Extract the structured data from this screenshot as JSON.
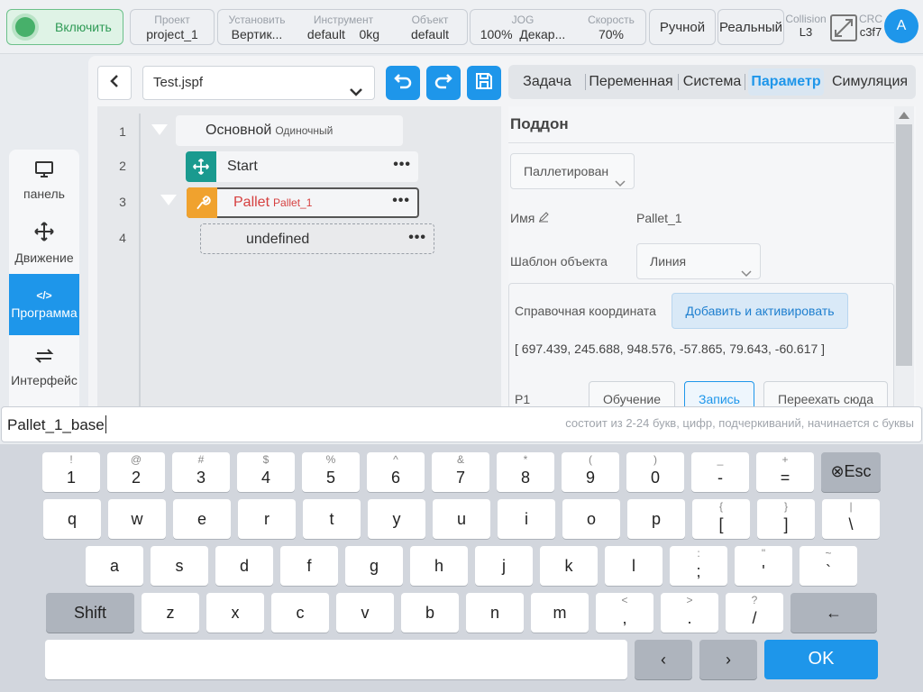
{
  "topbar": {
    "power_label": "Включить",
    "project": {
      "label": "Проект",
      "value": "project_1"
    },
    "install": {
      "label": "Установить",
      "value": "Вертик..."
    },
    "tool": {
      "label": "Инструмент",
      "value": "default",
      "value2": "0kg"
    },
    "object": {
      "label": "Объект",
      "value": "default"
    },
    "jog": {
      "label": "JOG",
      "value": "100%",
      "value2": "Декар..."
    },
    "speed": {
      "label": "Скорость",
      "value": "70%"
    },
    "mode_manual": "Ручной",
    "mode_real": "Реальный",
    "collision": {
      "label": "Collision",
      "value": "L3"
    },
    "crc": {
      "label": "CRC",
      "value": "c3f7"
    },
    "avatar": "A"
  },
  "leftnav": [
    {
      "label": "панель",
      "icon": "monitor-icon"
    },
    {
      "label": "Движение",
      "icon": "move-icon"
    },
    {
      "label": "Программа",
      "icon": "code-icon",
      "active": true
    },
    {
      "label": "Интерфейс",
      "icon": "interface-icon"
    }
  ],
  "editor": {
    "file_name": "Test.jspf",
    "lines": [
      "1",
      "2",
      "3",
      "4"
    ],
    "nodes": {
      "main": {
        "label": "Основной",
        "sub": "Одиночный"
      },
      "start": {
        "label": "Start"
      },
      "pallet": {
        "label": "Pallet",
        "sub": "Pallet_1"
      },
      "undefined": {
        "label": "undefined"
      }
    },
    "more": "•••"
  },
  "tabs": [
    "Задача",
    "Переменная",
    "Система",
    "Параметр",
    "Симуляция"
  ],
  "active_tab": "Параметр",
  "params": {
    "title": "Поддон",
    "type_select": "Паллетирован",
    "name_label": "Имя",
    "name_value": "Pallet_1",
    "template_label": "Шаблон объекта",
    "template_value": "Линия",
    "ref_label": "Справочная координата",
    "add_button": "Добавить и активировать",
    "coords": "[ 697.439, 245.688, 948.576, -57.865, 79.643, -60.617 ]",
    "p1_label": "P1",
    "btn_teach": "Обучение",
    "btn_record": "Запись",
    "btn_move": "Переехать сюда"
  },
  "input": {
    "value": "Pallet_1_base",
    "hint": "состоит из 2-24 букв, цифр, подчеркиваний, начинается с буквы"
  },
  "keyboard": {
    "row1": [
      {
        "m": "1",
        "s": "!"
      },
      {
        "m": "2",
        "s": "@"
      },
      {
        "m": "3",
        "s": "#"
      },
      {
        "m": "4",
        "s": "$"
      },
      {
        "m": "5",
        "s": "%"
      },
      {
        "m": "6",
        "s": "^"
      },
      {
        "m": "7",
        "s": "&"
      },
      {
        "m": "8",
        "s": "*"
      },
      {
        "m": "9",
        "s": "("
      },
      {
        "m": "0",
        "s": ")"
      },
      {
        "m": "-",
        "s": "_"
      },
      {
        "m": "=",
        "s": "+"
      }
    ],
    "esc": "⊗Esc",
    "row2": [
      {
        "m": "q"
      },
      {
        "m": "w"
      },
      {
        "m": "e"
      },
      {
        "m": "r"
      },
      {
        "m": "t"
      },
      {
        "m": "y"
      },
      {
        "m": "u"
      },
      {
        "m": "i"
      },
      {
        "m": "o"
      },
      {
        "m": "p"
      },
      {
        "m": "[",
        "s": "{"
      },
      {
        "m": "]",
        "s": "}"
      },
      {
        "m": "\\",
        "s": "|"
      }
    ],
    "row3": [
      {
        "m": "a"
      },
      {
        "m": "s"
      },
      {
        "m": "d"
      },
      {
        "m": "f"
      },
      {
        "m": "g"
      },
      {
        "m": "h"
      },
      {
        "m": "j"
      },
      {
        "m": "k"
      },
      {
        "m": "l"
      },
      {
        "m": ";",
        "s": ":"
      },
      {
        "m": "'",
        "s": "\""
      },
      {
        "m": "`",
        "s": "~"
      }
    ],
    "shift": "Shift",
    "row4": [
      {
        "m": "z"
      },
      {
        "m": "x"
      },
      {
        "m": "c"
      },
      {
        "m": "v"
      },
      {
        "m": "b"
      },
      {
        "m": "n"
      },
      {
        "m": "m"
      },
      {
        "m": ",",
        "s": "<"
      },
      {
        "m": ".",
        "s": ">"
      },
      {
        "m": "/",
        "s": "?"
      }
    ],
    "backspace": "←",
    "left": "‹",
    "right": "›",
    "ok": "OK"
  }
}
